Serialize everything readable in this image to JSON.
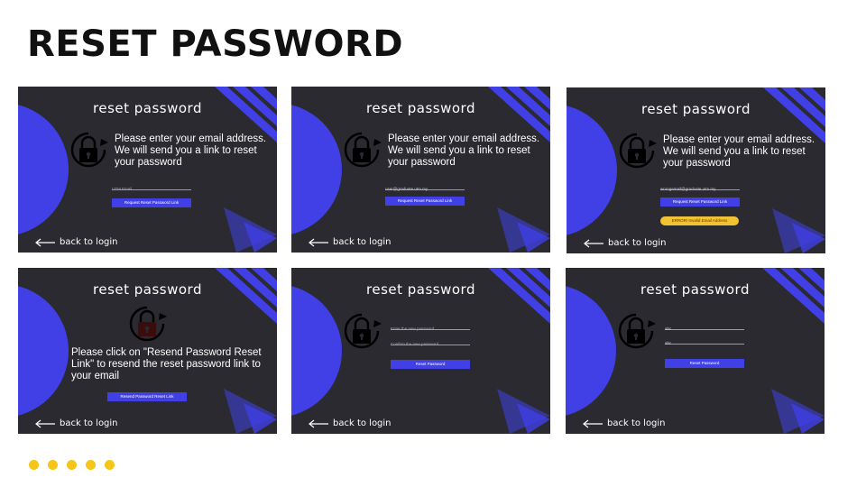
{
  "title": "RESET PASSWORD",
  "colors": {
    "accent": "#4040e6",
    "panel_bg": "#2b2a30",
    "warning": "#f2c235",
    "dots": "#f5c518"
  },
  "brand_text": "reset password",
  "back_text": "back to login",
  "icons": {
    "lock": "lock-refresh-icon",
    "back": "arrow-left-icon"
  },
  "panels": [
    {
      "message": "Please enter your email address. We will send you a link to reset your password",
      "email_placeholder": "UTM Email",
      "button": "Request Reset Password Link"
    },
    {
      "message": "Please enter your email address. We will send you a link to reset your password",
      "email_value": "user@graduate.utm.my",
      "button": "Request Reset Password Link"
    },
    {
      "message": "Please enter your email address. We will send you a link to reset your password",
      "email_value": "wrongemail@graduate.utm.my",
      "button": "Request Reset Password Link",
      "error": "ERROR! Invalid Email Address"
    },
    {
      "message": "Please click on \"Resend Password Reset Link\" to resend the reset password link to your email",
      "button": "Resend Password Reset Link"
    },
    {
      "new_password_placeholder": "Enter the new password",
      "confirm_password_placeholder": "Confirm the new password",
      "button": "Reset Password"
    },
    {
      "new_password_value": "abc",
      "confirm_password_value": "abc",
      "button": "Reset Password"
    }
  ],
  "pagination_dots": 5
}
